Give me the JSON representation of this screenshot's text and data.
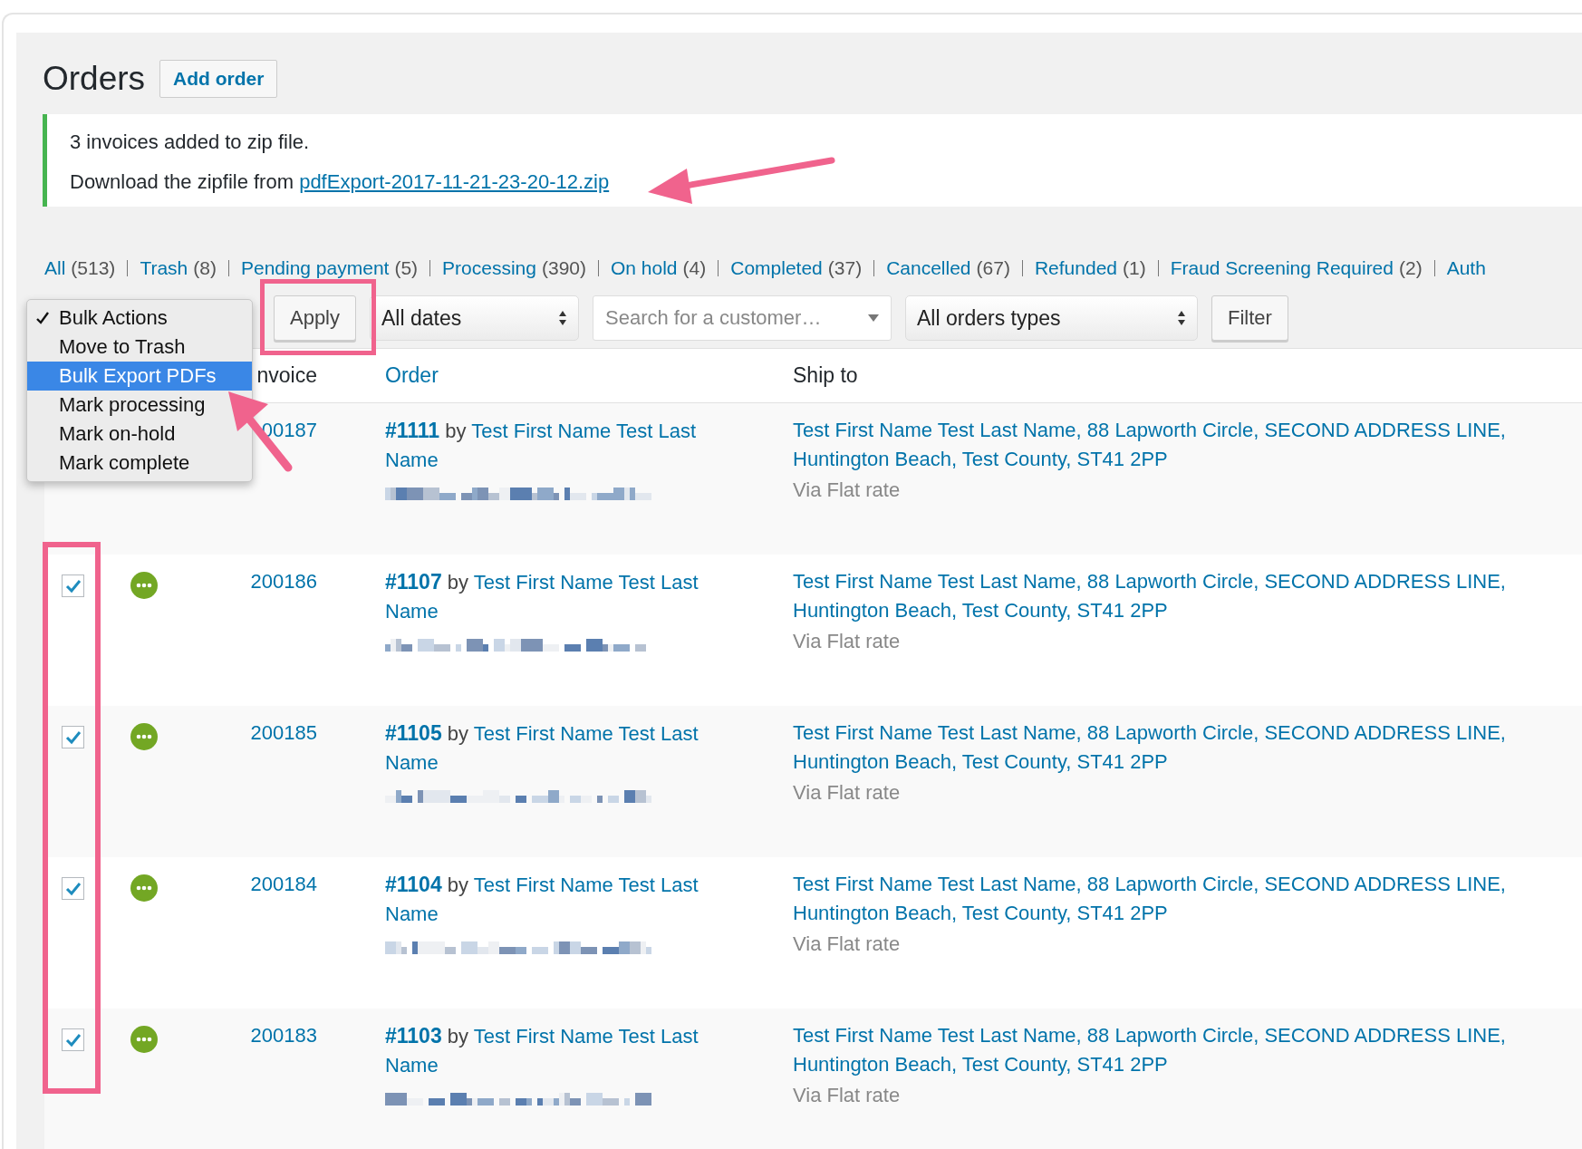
{
  "page": {
    "title": "Orders",
    "add_button": "Add order"
  },
  "notice": {
    "message": "3 invoices added to zip file.",
    "download_text": "Download the zipfile from",
    "download_link": "pdfExport-2017-11-21-23-20-12.zip"
  },
  "status_filters": [
    {
      "label": "All",
      "count": "(513)"
    },
    {
      "label": "Trash",
      "count": "(8)"
    },
    {
      "label": "Pending payment",
      "count": "(5)"
    },
    {
      "label": "Processing",
      "count": "(390)"
    },
    {
      "label": "On hold",
      "count": "(4)"
    },
    {
      "label": "Completed",
      "count": "(37)"
    },
    {
      "label": "Cancelled",
      "count": "(67)"
    },
    {
      "label": "Refunded",
      "count": "(1)"
    },
    {
      "label": "Fraud Screening Required",
      "count": "(2)"
    },
    {
      "label": "Auth"
    }
  ],
  "bulk_menu": {
    "items": [
      {
        "label": "Bulk Actions",
        "checked": true,
        "selected": false
      },
      {
        "label": "Move to Trash",
        "checked": false,
        "selected": false
      },
      {
        "label": "Bulk Export PDFs",
        "checked": false,
        "selected": true
      },
      {
        "label": "Mark processing",
        "checked": false,
        "selected": false
      },
      {
        "label": "Mark on-hold",
        "checked": false,
        "selected": false
      },
      {
        "label": "Mark complete",
        "checked": false,
        "selected": false
      }
    ]
  },
  "apply_button": "Apply",
  "date_filter": {
    "value": "All dates"
  },
  "customer_search": {
    "placeholder": "Search for a customer…"
  },
  "type_filter": {
    "value": "All orders types"
  },
  "filter_button": "Filter",
  "table": {
    "columns": [
      "nvoice",
      "Order",
      "Ship to"
    ],
    "rows": [
      {
        "invoice": "00187",
        "order_number": "#1111",
        "by": "by",
        "customer": "Test First Name Test Last Name",
        "ship_to": "Test First Name Test Last Name, 88 Lapworth Circle, SECOND ADDRESS LINE, Huntington Beach, Test County, ST41 2PP",
        "shipping_method": "Via Flat rate"
      },
      {
        "checked": true,
        "invoice": "200186",
        "order_number": "#1107",
        "by": "by",
        "customer": "Test First Name Test Last Name",
        "ship_to": "Test First Name Test Last Name, 88 Lapworth Circle, SECOND ADDRESS LINE, Huntington Beach, Test County, ST41 2PP",
        "shipping_method": "Via Flat rate"
      },
      {
        "checked": true,
        "invoice": "200185",
        "order_number": "#1105",
        "by": "by",
        "customer": "Test First Name Test Last Name",
        "ship_to": "Test First Name Test Last Name, 88 Lapworth Circle, SECOND ADDRESS LINE, Huntington Beach, Test County, ST41 2PP",
        "shipping_method": "Via Flat rate"
      },
      {
        "checked": true,
        "invoice": "200184",
        "order_number": "#1104",
        "by": "by",
        "customer": "Test First Name Test Last Name",
        "ship_to": "Test First Name Test Last Name, 88 Lapworth Circle, SECOND ADDRESS LINE, Huntington Beach, Test County, ST41 2PP",
        "shipping_method": "Via Flat rate"
      },
      {
        "checked": true,
        "invoice": "200183",
        "order_number": "#1103",
        "by": "by",
        "customer": "Test First Name Test Last Name",
        "ship_to": "Test First Name Test Last Name, 88 Lapworth Circle, SECOND ADDRESS LINE, Huntington Beach, Test County, ST41 2PP",
        "shipping_method": "Via Flat rate"
      }
    ]
  }
}
